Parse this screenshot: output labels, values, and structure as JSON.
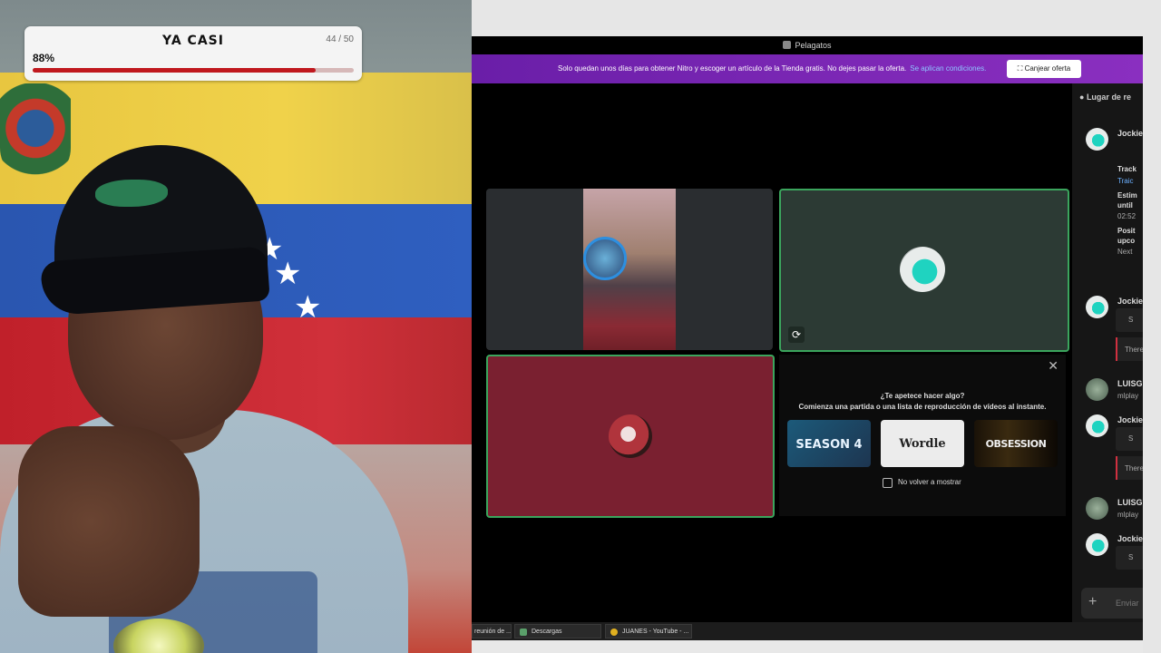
{
  "progress": {
    "title": "YA CASI",
    "count": "44 / 50",
    "percent_text": "88%",
    "value": 0.88
  },
  "flag_star_icon": "star-icon",
  "discord": {
    "window_title": "Pelagatos",
    "banner": {
      "text": "Solo quedan unos días para obtener Nitro y escoger un artículo de la Tienda gratis. No dejes pasar la oferta.",
      "link": "Se aplican condiciones.",
      "button": "Canjear oferta"
    },
    "activity": {
      "question": "¿Te apetece hacer algo?",
      "subtitle": "Comienza una partida o una lista de reproducción de vídeos al instante.",
      "cards": [
        "SEASON 4",
        "Wordle",
        "OBSESSION"
      ],
      "checkbox_label": "No volver a mostrar"
    },
    "chat": {
      "header": "Lugar de re",
      "messages": [
        {
          "name": "Jockie",
          "lines": [
            "Track",
            "Traic",
            "Estim",
            "until",
            "02:52",
            "Posit",
            "upco",
            "Next"
          ]
        },
        {
          "name": "Jockie",
          "lines": [
            "S"
          ],
          "embed": "There"
        },
        {
          "name": "LUISG",
          "lines": [
            "mlplay"
          ]
        },
        {
          "name": "Jockie",
          "lines": [
            "S"
          ],
          "embed": "There"
        },
        {
          "name": "LUISG",
          "lines": [
            "mlplay"
          ]
        },
        {
          "name": "Jockie",
          "lines": [
            "S"
          ]
        }
      ],
      "input_placeholder": "Enviar"
    },
    "taskbar": [
      "reunión de ...",
      "Descargas",
      "JUANES - YouTube - ..."
    ]
  }
}
